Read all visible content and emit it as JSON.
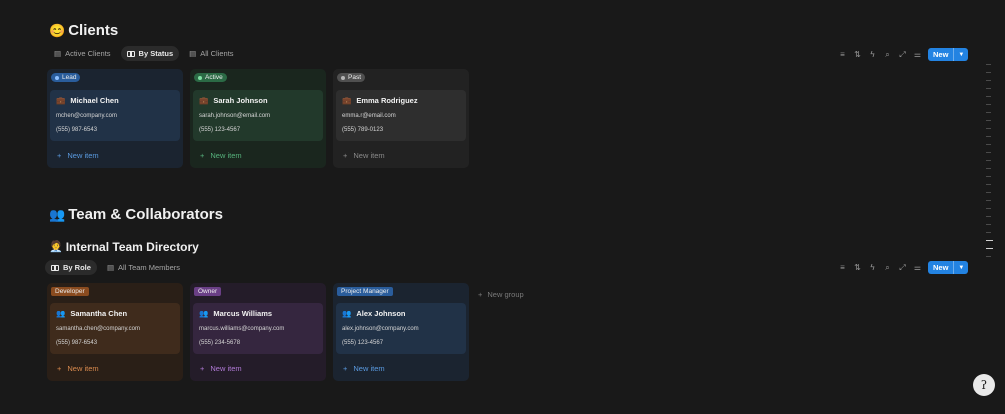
{
  "clients": {
    "emoji": "😊",
    "title": "Clients",
    "views": [
      {
        "label": "Active Clients",
        "active": false
      },
      {
        "label": "By Status",
        "active": true
      },
      {
        "label": "All Clients",
        "active": false
      }
    ],
    "toolbar": {
      "new_label": "New"
    },
    "columns": [
      {
        "label": "Lead",
        "color": "#2a5d9c",
        "bg": "#1b2430",
        "card_bg": "#213247",
        "new_color": "#5a9ae0",
        "card": {
          "icon": "💼",
          "name": "Michael Chen",
          "email": "mchen@company.com",
          "phone": "(555) 987-6543"
        },
        "new_item": "New item"
      },
      {
        "label": "Active",
        "color": "#2b6a45",
        "bg": "#1a261e",
        "card_bg": "#22392b",
        "new_color": "#56b27c",
        "card": {
          "icon": "💼",
          "name": "Sarah Johnson",
          "email": "sarah.johnson@email.com",
          "phone": "(555) 123-4567"
        },
        "new_item": "New item"
      },
      {
        "label": "Past",
        "color": "#505050",
        "bg": "#222222",
        "card_bg": "#2e2e2e",
        "new_color": "#8a8a8a",
        "card": {
          "icon": "💼",
          "name": "Emma Rodriguez",
          "email": "emma.r@email.com",
          "phone": "(555) 789-0123"
        },
        "new_item": "New item"
      }
    ]
  },
  "team": {
    "emoji": "👥",
    "title": "Team & Collaborators"
  },
  "directory": {
    "emoji": "🧑‍💼",
    "title": "Internal Team Directory",
    "views": [
      {
        "label": "By Role",
        "active": true
      },
      {
        "label": "All Team Members",
        "active": false
      }
    ],
    "toolbar": {
      "new_label": "New"
    },
    "new_group": "New group",
    "columns": [
      {
        "label": "Developer",
        "color": "#8a4b1f",
        "bg": "#2a1f17",
        "card_bg": "#3f2b1c",
        "new_color": "#d98a4e",
        "card": {
          "icon": "👥",
          "name": "Samantha Chen",
          "email": "samantha.chen@company.com",
          "phone": "(555) 987-6543"
        },
        "new_item": "New item"
      },
      {
        "label": "Owner",
        "color": "#6a3f86",
        "bg": "#241c29",
        "card_bg": "#35263f",
        "new_color": "#b07ad6",
        "card": {
          "icon": "👥",
          "name": "Marcus Williams",
          "email": "marcus.williams@company.com",
          "phone": "(555) 234-5678"
        },
        "new_item": "New item"
      },
      {
        "label": "Project Manager",
        "color": "#2a5d9c",
        "bg": "#1b2430",
        "card_bg": "#213247",
        "new_color": "#5a9ae0",
        "card": {
          "icon": "👥",
          "name": "Alex Johnson",
          "email": "alex.johnson@company.com",
          "phone": "(555) 123-4567"
        },
        "new_item": "New item"
      }
    ]
  },
  "help": {
    "icon": "help-icon",
    "glyph": "ʔ"
  }
}
